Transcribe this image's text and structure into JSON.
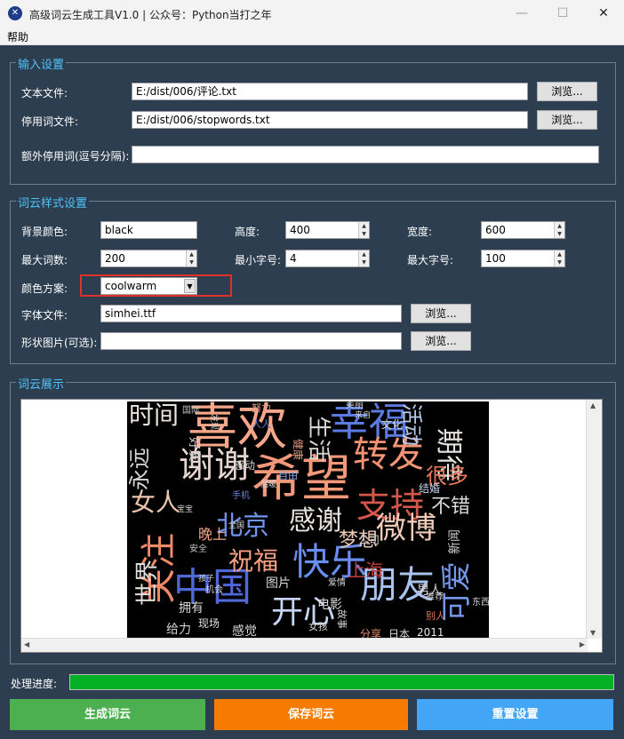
{
  "window": {
    "title": "高级词云生成工具V1.0 | 公众号：Python当打之年",
    "controls": [
      "—",
      "☐",
      "✕"
    ]
  },
  "menu": {
    "help": "帮助"
  },
  "input_settings": {
    "legend": "输入设置",
    "text_file_label": "文本文件:",
    "text_file_value": "E:/dist/006/评论.txt",
    "stopwords_label": "停用词文件:",
    "stopwords_value": "E:/dist/006/stopwords.txt",
    "extra_stopwords_label": "额外停用词(逗号分隔):",
    "extra_stopwords_value": "",
    "browse": "浏览..."
  },
  "style_settings": {
    "legend": "词云样式设置",
    "bg_color_label": "背景颜色:",
    "bg_color_value": "black",
    "height_label": "高度:",
    "height_value": "400",
    "width_label": "宽度:",
    "width_value": "600",
    "max_words_label": "最大词数:",
    "max_words_value": "200",
    "min_font_label": "最小字号:",
    "min_font_value": "4",
    "max_font_label": "最大字号:",
    "max_font_value": "100",
    "colormap_label": "颜色方案:",
    "colormap_value": "coolwarm",
    "font_file_label": "字体文件:",
    "font_file_value": "simhei.ttf",
    "mask_label": "形状图片(可选):",
    "mask_value": "",
    "browse": "浏览..."
  },
  "display": {
    "legend": "词云展示"
  },
  "wordcloud": [
    {
      "text": "喜欢",
      "color": "#f7a789"
    },
    {
      "text": "希望",
      "color": "#f4987a"
    },
    {
      "text": "幸福",
      "color": "#5b7be0"
    },
    {
      "text": "谢谢",
      "color": "#e6d6cf"
    },
    {
      "text": "中国",
      "color": "#4e68d8"
    },
    {
      "text": "快乐",
      "color": "#6a8ef0"
    },
    {
      "text": "开心",
      "color": "#c5d5f5"
    },
    {
      "text": "朋友",
      "color": "#aac2ee"
    },
    {
      "text": "关注",
      "color": "#f08a6a"
    },
    {
      "text": "转发",
      "color": "#f29474"
    },
    {
      "text": "支持",
      "color": "#d4584a"
    },
    {
      "text": "感谢",
      "color": "#e8e2dc"
    },
    {
      "text": "微博",
      "color": "#efcbb8"
    },
    {
      "text": "北京",
      "color": "#6f94ee"
    },
    {
      "text": "祝福",
      "color": "#f5a083"
    },
    {
      "text": "期待",
      "color": "#e6e2de"
    },
    {
      "text": "时间",
      "color": "#e9e4df"
    },
    {
      "text": "永远",
      "color": "#d8d6d3"
    },
    {
      "text": "可爱",
      "color": "#7597ea"
    },
    {
      "text": "女人",
      "color": "#edc4ad"
    },
    {
      "text": "世界",
      "color": "#e0dedb"
    },
    {
      "text": "很多",
      "color": "#e8785c"
    },
    {
      "text": "不错",
      "color": "#dcdad8"
    },
    {
      "text": "梦想",
      "color": "#ecc9b5"
    },
    {
      "text": "上海",
      "color": "#c33b3a"
    },
    {
      "text": "生活",
      "color": "#d9d7d4"
    },
    {
      "text": "活动",
      "color": "#b8cbe8"
    },
    {
      "text": "男人",
      "color": "#cfcfcf"
    },
    {
      "text": "晚上",
      "color": "#f3a587"
    },
    {
      "text": "给力",
      "color": "#d0d0d0"
    },
    {
      "text": "图片",
      "color": "#d6d6d6"
    },
    {
      "text": "感觉",
      "color": "#d5d5d5"
    },
    {
      "text": "新闻",
      "color": "#cfcfcf"
    },
    {
      "text": "公司",
      "color": "#d3d3d3"
    },
    {
      "text": "拥有",
      "color": "#d9d9d9"
    },
    {
      "text": "电影",
      "color": "#d7d7d7"
    },
    {
      "text": "日本",
      "color": "#dadada"
    },
    {
      "text": "2011",
      "color": "#e5e5e5"
    },
    {
      "text": "分享",
      "color": "#ef8c6f"
    },
    {
      "text": "现场",
      "color": "#e3e3e3"
    },
    {
      "text": "健康",
      "color": "#e49b82"
    },
    {
      "text": "感动",
      "color": "#d8d8d8"
    },
    {
      "text": "自由",
      "color": "#8fa8e8"
    },
    {
      "text": "手机",
      "color": "#6c86d6"
    },
    {
      "text": "好友",
      "color": "#d3d3d3"
    },
    {
      "text": "爱情",
      "color": "#d6d6d6"
    },
    {
      "text": "机会",
      "color": "#d4d4d4"
    },
    {
      "text": "女孩",
      "color": "#d4d4d4"
    },
    {
      "text": "文化",
      "color": "#d8d8d8"
    },
    {
      "text": "结婚",
      "color": "#c8d7f2"
    },
    {
      "text": "美丽",
      "color": "#cfcfcf"
    },
    {
      "text": "努力",
      "color": "#e19a82"
    },
    {
      "text": "人人",
      "color": "#5a78e0"
    },
    {
      "text": "国际",
      "color": "#c4c4c4"
    },
    {
      "text": "故事",
      "color": "#d0d0d0"
    },
    {
      "text": "安全",
      "color": "#c6c6c6"
    },
    {
      "text": "推荐",
      "color": "#d2d2d2"
    },
    {
      "text": "别人",
      "color": "#e2765d"
    },
    {
      "text": "东西",
      "color": "#d4d4d4"
    },
    {
      "text": "全国",
      "color": "#d6d6d6"
    },
    {
      "text": "宝宝",
      "color": "#c9c9c9"
    },
    {
      "text": "温暖",
      "color": "#d3d3d3"
    },
    {
      "text": "孩子",
      "color": "#d0d0d0"
    },
    {
      "text": "来自",
      "color": "#d7d7d7"
    },
    {
      "text": "发现",
      "color": "#d5d5d5"
    }
  ],
  "progress": {
    "label": "处理进度:",
    "percent": 100
  },
  "actions": {
    "generate": "生成词云",
    "save": "保存词云",
    "reset": "重置设置",
    "colors": {
      "generate": "#4caf50",
      "save": "#f57c00",
      "reset": "#42a5f5"
    }
  }
}
